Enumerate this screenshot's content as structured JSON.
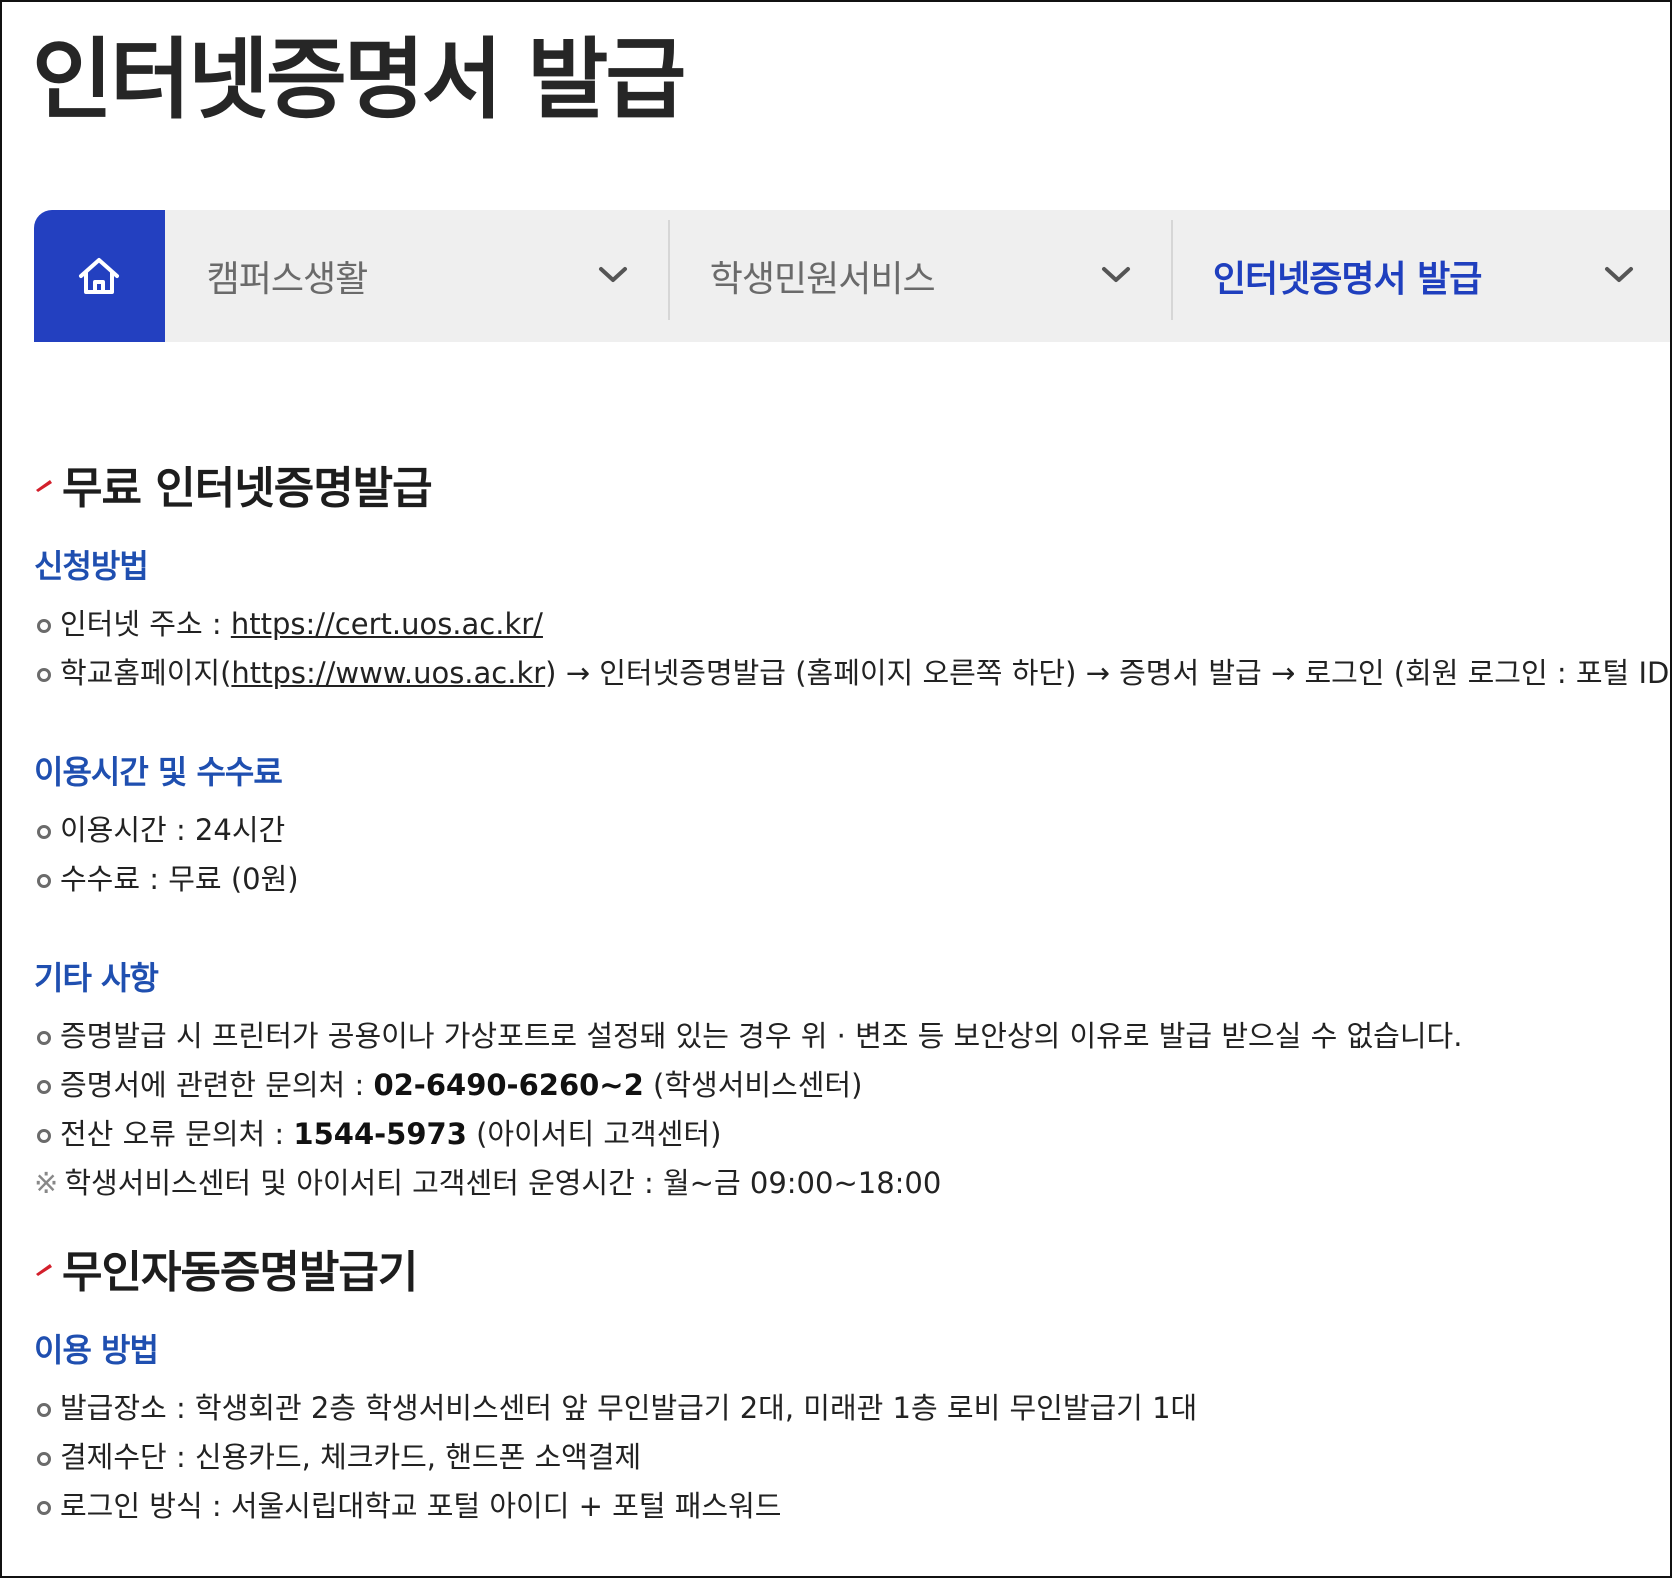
{
  "page": {
    "title": "인터넷증명서 발급"
  },
  "nav": {
    "home_icon": "home-icon",
    "items": [
      {
        "label": "캠퍼스생활",
        "active": false
      },
      {
        "label": "학생민원서비스",
        "active": false
      },
      {
        "label": "인터넷증명서 발급",
        "active": true
      }
    ]
  },
  "colors": {
    "accent": "#2340c0",
    "subheading": "#1f4fb0",
    "mark": "#d31f2b"
  },
  "sections": [
    {
      "title": "무료 인터넷증명발급",
      "groups": [
        {
          "heading": "신청방법",
          "items": [
            {
              "prefix": "인터넷 주소 : ",
              "link": "https://cert.uos.ac.kr/"
            },
            {
              "prefix": "학교홈페이지(",
              "link": "https://www.uos.ac.kr",
              "suffix": ") → 인터넷증명발급 (홈페이지 오른쪽 하단) → 증명서 발급 → 로그인 (회원 로그인 : 포털 ID 및"
            }
          ]
        },
        {
          "heading": "이용시간 및 수수료",
          "items": [
            {
              "text": "이용시간 : 24시간"
            },
            {
              "text": "수수료 : 무료 (0원)"
            }
          ]
        },
        {
          "heading": "기타 사항",
          "items": [
            {
              "text": "증명발급 시 프린터가 공용이나 가상포트로 설정돼 있는 경우 위 · 변조 등 보안상의 이유로 발급 받으실 수 없습니다."
            },
            {
              "prefix": "증명서에 관련한 문의처 : ",
              "bold": "02-6490-6260~2",
              "suffix": " (학생서비스센터)"
            },
            {
              "prefix": "전산 오류 문의처 : ",
              "bold": "1544-5973",
              "suffix": " (아이서티 고객센터)"
            }
          ],
          "note_mark": "※",
          "note": "학생서비스센터 및 아이서티 고객센터 운영시간 : 월~금 09:00~18:00"
        }
      ]
    },
    {
      "title": "무인자동증명발급기",
      "groups": [
        {
          "heading": "이용 방법",
          "items": [
            {
              "text": "발급장소 : 학생회관 2층 학생서비스센터 앞 무인발급기 2대, 미래관 1층 로비 무인발급기 1대"
            },
            {
              "text": "결제수단 : 신용카드, 체크카드, 핸드폰 소액결제"
            },
            {
              "text": "로그인 방식 : 서울시립대학교 포털 아이디 + 포털 패스워드"
            }
          ]
        }
      ]
    }
  ]
}
